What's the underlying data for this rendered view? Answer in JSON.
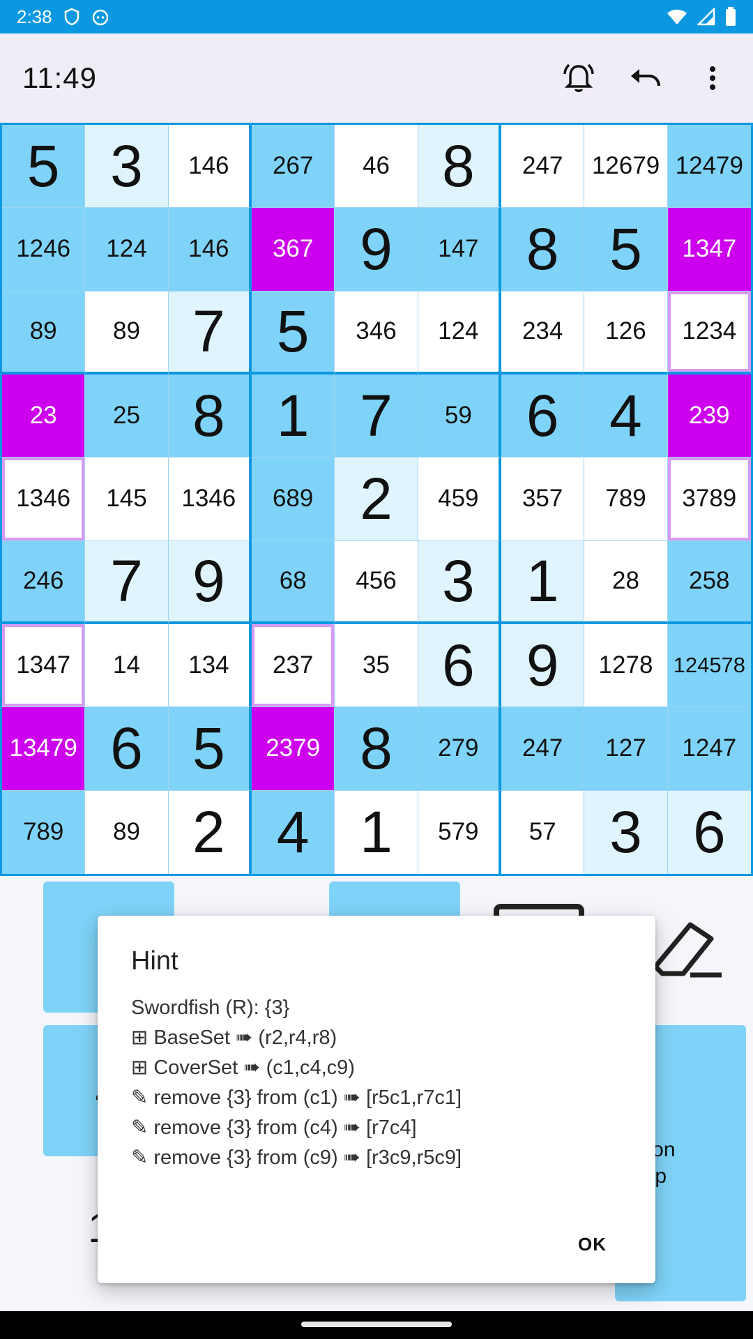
{
  "status_bar": {
    "time": "2:38",
    "icons": [
      "shield-icon",
      "cat-icon",
      "wifi-icon",
      "signal-icon",
      "battery-icon"
    ]
  },
  "app_bar": {
    "timer": "11:49",
    "actions": [
      "alarm-icon",
      "undo-icon",
      "more-vert-icon"
    ]
  },
  "grid": {
    "cells": [
      [
        {
          "v": "5",
          "t": "given",
          "c": "blue"
        },
        {
          "v": "3",
          "t": "given",
          "c": "light"
        },
        {
          "v": "146",
          "t": "cand",
          "c": "white"
        },
        {
          "v": "267",
          "t": "cand",
          "c": "blue"
        },
        {
          "v": "46",
          "t": "cand",
          "c": "white"
        },
        {
          "v": "8",
          "t": "given",
          "c": "light"
        },
        {
          "v": "247",
          "t": "cand",
          "c": "white"
        },
        {
          "v": "12679",
          "t": "cand",
          "c": "white"
        },
        {
          "v": "12479",
          "t": "cand",
          "c": "blue"
        }
      ],
      [
        {
          "v": "1246",
          "t": "cand",
          "c": "blue"
        },
        {
          "v": "124",
          "t": "cand",
          "c": "blue"
        },
        {
          "v": "146",
          "t": "cand",
          "c": "blue"
        },
        {
          "v": "367",
          "t": "cand",
          "c": "magenta"
        },
        {
          "v": "9",
          "t": "given",
          "c": "blue"
        },
        {
          "v": "147",
          "t": "cand",
          "c": "blue"
        },
        {
          "v": "8",
          "t": "given",
          "c": "blue"
        },
        {
          "v": "5",
          "t": "given",
          "c": "blue"
        },
        {
          "v": "1347",
          "t": "cand",
          "c": "magenta"
        }
      ],
      [
        {
          "v": "89",
          "t": "cand",
          "c": "blue"
        },
        {
          "v": "89",
          "t": "cand",
          "c": "white"
        },
        {
          "v": "7",
          "t": "given",
          "c": "light"
        },
        {
          "v": "5",
          "t": "given",
          "c": "blue"
        },
        {
          "v": "346",
          "t": "cand",
          "c": "white"
        },
        {
          "v": "124",
          "t": "cand",
          "c": "white"
        },
        {
          "v": "234",
          "t": "cand",
          "c": "white"
        },
        {
          "v": "126",
          "t": "cand",
          "c": "white"
        },
        {
          "v": "1234",
          "t": "cand",
          "c": "outline"
        }
      ],
      [
        {
          "v": "23",
          "t": "cand",
          "c": "magenta"
        },
        {
          "v": "25",
          "t": "cand",
          "c": "blue"
        },
        {
          "v": "8",
          "t": "given",
          "c": "blue"
        },
        {
          "v": "1",
          "t": "given",
          "c": "blue"
        },
        {
          "v": "7",
          "t": "given",
          "c": "blue"
        },
        {
          "v": "59",
          "t": "cand",
          "c": "blue"
        },
        {
          "v": "6",
          "t": "given",
          "c": "blue"
        },
        {
          "v": "4",
          "t": "given",
          "c": "blue"
        },
        {
          "v": "239",
          "t": "cand",
          "c": "magenta"
        }
      ],
      [
        {
          "v": "1346",
          "t": "cand",
          "c": "outline"
        },
        {
          "v": "145",
          "t": "cand",
          "c": "white"
        },
        {
          "v": "1346",
          "t": "cand",
          "c": "white"
        },
        {
          "v": "689",
          "t": "cand",
          "c": "blue"
        },
        {
          "v": "2",
          "t": "given",
          "c": "light"
        },
        {
          "v": "459",
          "t": "cand",
          "c": "white"
        },
        {
          "v": "357",
          "t": "cand",
          "c": "white"
        },
        {
          "v": "789",
          "t": "cand",
          "c": "white"
        },
        {
          "v": "3789",
          "t": "cand",
          "c": "outline"
        }
      ],
      [
        {
          "v": "246",
          "t": "cand",
          "c": "blue"
        },
        {
          "v": "7",
          "t": "given",
          "c": "light"
        },
        {
          "v": "9",
          "t": "given",
          "c": "light"
        },
        {
          "v": "68",
          "t": "cand",
          "c": "blue"
        },
        {
          "v": "456",
          "t": "cand",
          "c": "white"
        },
        {
          "v": "3",
          "t": "given",
          "c": "light"
        },
        {
          "v": "1",
          "t": "given",
          "c": "light"
        },
        {
          "v": "28",
          "t": "cand",
          "c": "white"
        },
        {
          "v": "258",
          "t": "cand",
          "c": "blue"
        }
      ],
      [
        {
          "v": "1347",
          "t": "cand",
          "c": "outline"
        },
        {
          "v": "14",
          "t": "cand",
          "c": "white"
        },
        {
          "v": "134",
          "t": "cand",
          "c": "white"
        },
        {
          "v": "237",
          "t": "cand",
          "c": "outline"
        },
        {
          "v": "35",
          "t": "cand",
          "c": "white"
        },
        {
          "v": "6",
          "t": "given",
          "c": "light"
        },
        {
          "v": "9",
          "t": "given",
          "c": "light"
        },
        {
          "v": "1278",
          "t": "cand",
          "c": "white"
        },
        {
          "v": "124578",
          "t": "cand",
          "c": "blue"
        }
      ],
      [
        {
          "v": "13479",
          "t": "cand",
          "c": "magenta"
        },
        {
          "v": "6",
          "t": "given",
          "c": "blue"
        },
        {
          "v": "5",
          "t": "given",
          "c": "blue"
        },
        {
          "v": "2379",
          "t": "cand",
          "c": "magenta"
        },
        {
          "v": "8",
          "t": "given",
          "c": "blue"
        },
        {
          "v": "279",
          "t": "cand",
          "c": "blue"
        },
        {
          "v": "247",
          "t": "cand",
          "c": "blue"
        },
        {
          "v": "127",
          "t": "cand",
          "c": "blue"
        },
        {
          "v": "1247",
          "t": "cand",
          "c": "blue"
        }
      ],
      [
        {
          "v": "789",
          "t": "cand",
          "c": "blue"
        },
        {
          "v": "89",
          "t": "cand",
          "c": "white"
        },
        {
          "v": "2",
          "t": "given",
          "c": "white"
        },
        {
          "v": "4",
          "t": "given",
          "c": "blue"
        },
        {
          "v": "1",
          "t": "given",
          "c": "white"
        },
        {
          "v": "579",
          "t": "cand",
          "c": "white"
        },
        {
          "v": "57",
          "t": "cand",
          "c": "white"
        },
        {
          "v": "3",
          "t": "given",
          "c": "light"
        },
        {
          "v": "6",
          "t": "given",
          "c": "light"
        }
      ]
    ]
  },
  "controls": {
    "partial_digits": [
      "1",
      "4",
      "1"
    ],
    "select_label": "elect on\nell tap",
    "icons": [
      "eraser-icon",
      "notes-icon"
    ]
  },
  "dialog": {
    "title": "Hint",
    "lines": [
      "Swordfish (R): {3}",
      "⊞ BaseSet ➠ (r2,r4,r8)",
      "⊞ CoverSet ➠ (c1,c4,c9)",
      "✎ remove {3} from (c1) ➠ [r5c1,r7c1]",
      "✎ remove {3} from (c4) ➠ [r7c4]",
      "✎ remove {3} from (c9) ➠ [r3c9,r5c9]"
    ],
    "ok_label": "OK"
  },
  "colors": {
    "status_bar": "#0b98e0",
    "cell_blue": "#7fd3f8",
    "cell_light": "#e0f4fd",
    "cell_magenta": "#cc00ee",
    "cell_outline": "#d79af4"
  }
}
